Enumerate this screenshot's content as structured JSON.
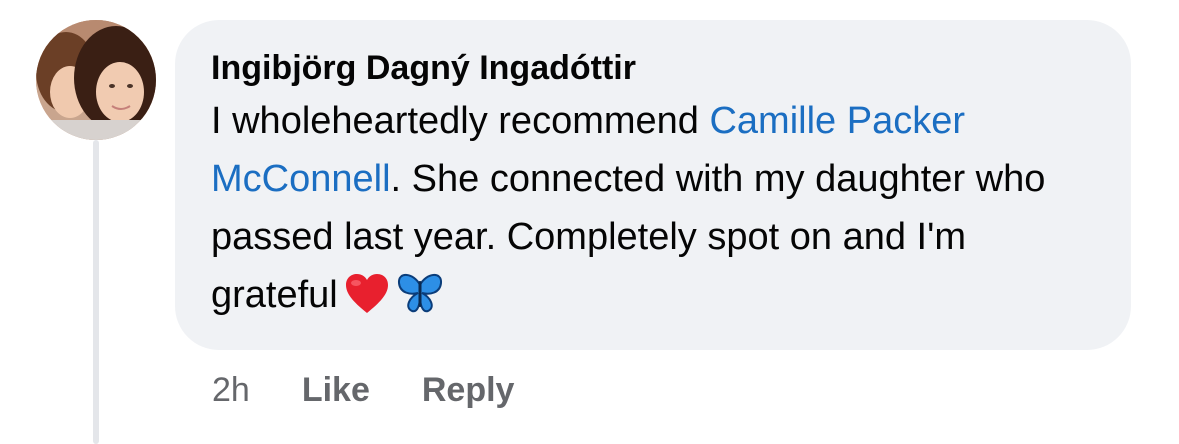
{
  "comment": {
    "author": "Ingibjörg Dagný Ingadóttir",
    "text_before_mention": "I wholeheartedly recommend ",
    "mention": "Camille Packer McConnell",
    "text_after_mention": ". She connected with my daughter who passed last year. Completely spot on and I'm grateful",
    "emojis": [
      "heart-emoji",
      "butterfly-emoji"
    ],
    "timestamp": "2h",
    "like_label": "Like",
    "reply_label": "Reply"
  },
  "colors": {
    "bubble": "#f0f2f5",
    "mention": "#1b6ec2",
    "meta": "#65676b",
    "heart": "#e8202e",
    "butterfly": "#2d8fe6"
  }
}
